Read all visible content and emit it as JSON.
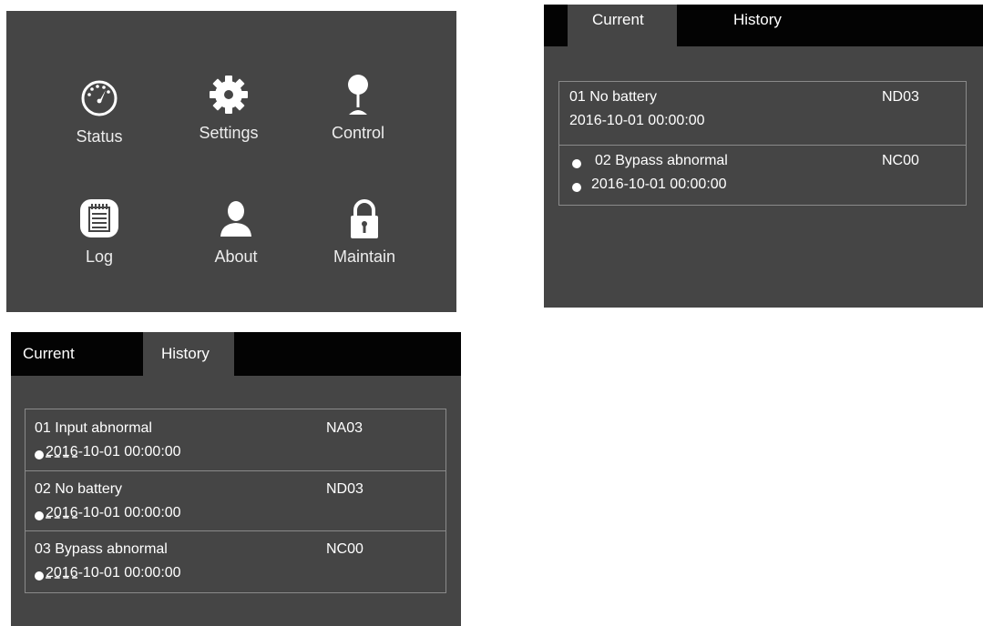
{
  "menu": {
    "items": [
      {
        "label": "Status",
        "icon": "speedometer-icon"
      },
      {
        "label": "Settings",
        "icon": "gear-icon"
      },
      {
        "label": "Control",
        "icon": "joystick-icon"
      },
      {
        "label": "Log",
        "icon": "notepad-icon"
      },
      {
        "label": "About",
        "icon": "person-icon"
      },
      {
        "label": "Maintain",
        "icon": "padlock-icon"
      }
    ]
  },
  "current_panel": {
    "tabs": [
      "Current",
      "History"
    ],
    "active_tab": "Current",
    "rows": [
      {
        "title": "01 No battery",
        "code": "ND03",
        "time": "2016-10-01 00:00:00"
      },
      {
        "title": "02 Bypass abnormal",
        "code": "NC00",
        "time": "2016-10-01 00:00:00"
      }
    ]
  },
  "history_panel": {
    "tabs": [
      "Current",
      "History"
    ],
    "active_tab": "History",
    "rows": [
      {
        "title": "01 Input abnormal",
        "code": "NA03",
        "time_year": "2016",
        "time_rest": "-10-01 00:00:00"
      },
      {
        "title": "02 No battery",
        "code": "ND03",
        "time_year": "2016",
        "time_rest": "-10-01 00:00:00"
      },
      {
        "title": "03 Bypass abnormal",
        "code": "NC00",
        "time_year": "2016",
        "time_rest": "-10-01 00:00:00"
      }
    ]
  },
  "colors": {
    "panel_bg": "#454545",
    "tabbar_bg": "#030303",
    "text": "#ffffff",
    "divider": "#8a8a8a"
  }
}
